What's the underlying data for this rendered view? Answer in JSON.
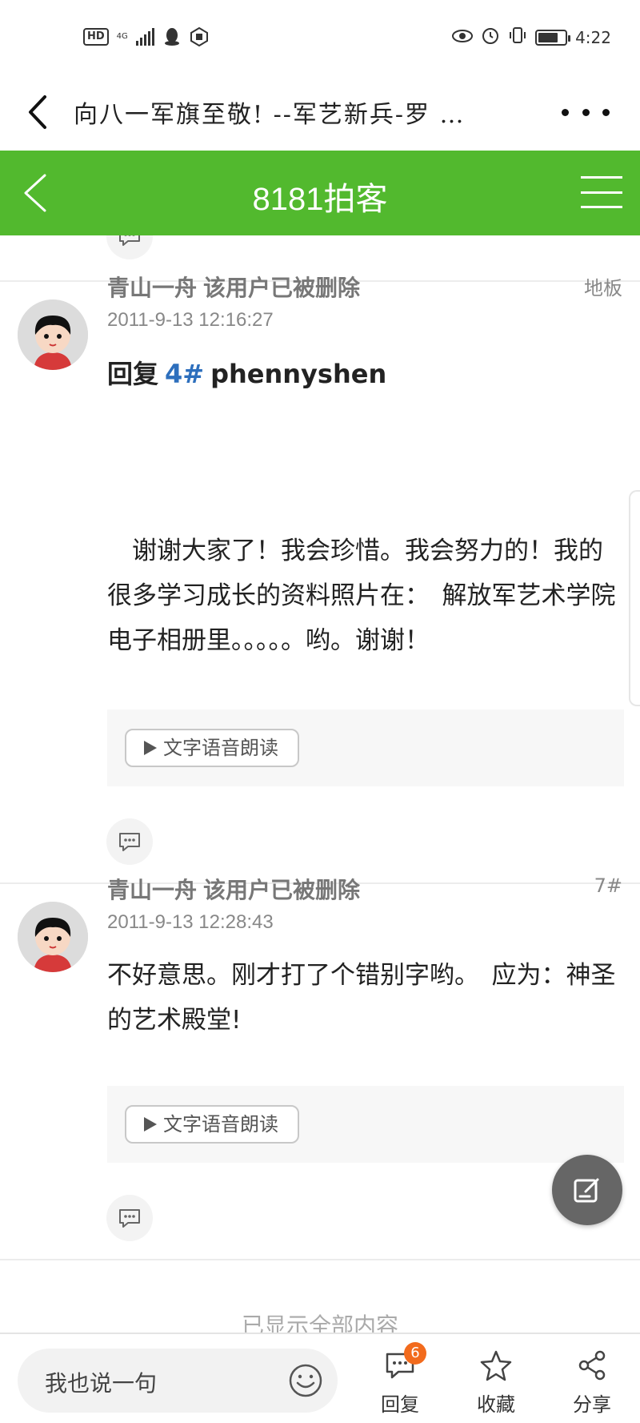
{
  "status_bar": {
    "hd": "HD",
    "network": "4G",
    "time": "4:22",
    "battery_level": 0.75
  },
  "browser": {
    "title": "向八一军旗至敬! --军艺新兵-罗 …"
  },
  "header": {
    "title": "8181拍客"
  },
  "posts": [
    {
      "username": "青山一舟",
      "status": "该用户已被删除",
      "floor": "地板",
      "time": "2011-9-13 12:16:27",
      "reply_prefix": "回复",
      "reply_num": "4#",
      "reply_user": "phennyshen",
      "body": "　谢谢大家了！我会珍惜。我会努力的！我的很多学习成长的资料照片在：　解放军艺术学院电子相册里。。。。。哟。谢谢！",
      "tts_label": "文字语音朗读"
    },
    {
      "username": "青山一舟",
      "status": "该用户已被删除",
      "floor": "7#",
      "time": "2011-9-13 12:28:43",
      "body": "不好意思。刚才打了个错别字哟。　应为：神圣的艺术殿堂!",
      "tts_label": "文字语音朗读"
    }
  ],
  "end_text": "已显示全部内容",
  "bottom_bar": {
    "input_placeholder": "我也说一句",
    "reply_label": "回复",
    "reply_count": "6",
    "favorite_label": "收藏",
    "share_label": "分享"
  },
  "colors": {
    "brand_green": "#52b92e",
    "link_blue": "#2d6fbd",
    "badge_orange": "#f26b1d"
  },
  "icons": [
    "back-icon",
    "more-icon",
    "menu-icon",
    "comment-icon",
    "avatar",
    "play-icon",
    "edit-icon",
    "emoji-icon",
    "reply-icon",
    "star-icon",
    "share-icon"
  ]
}
